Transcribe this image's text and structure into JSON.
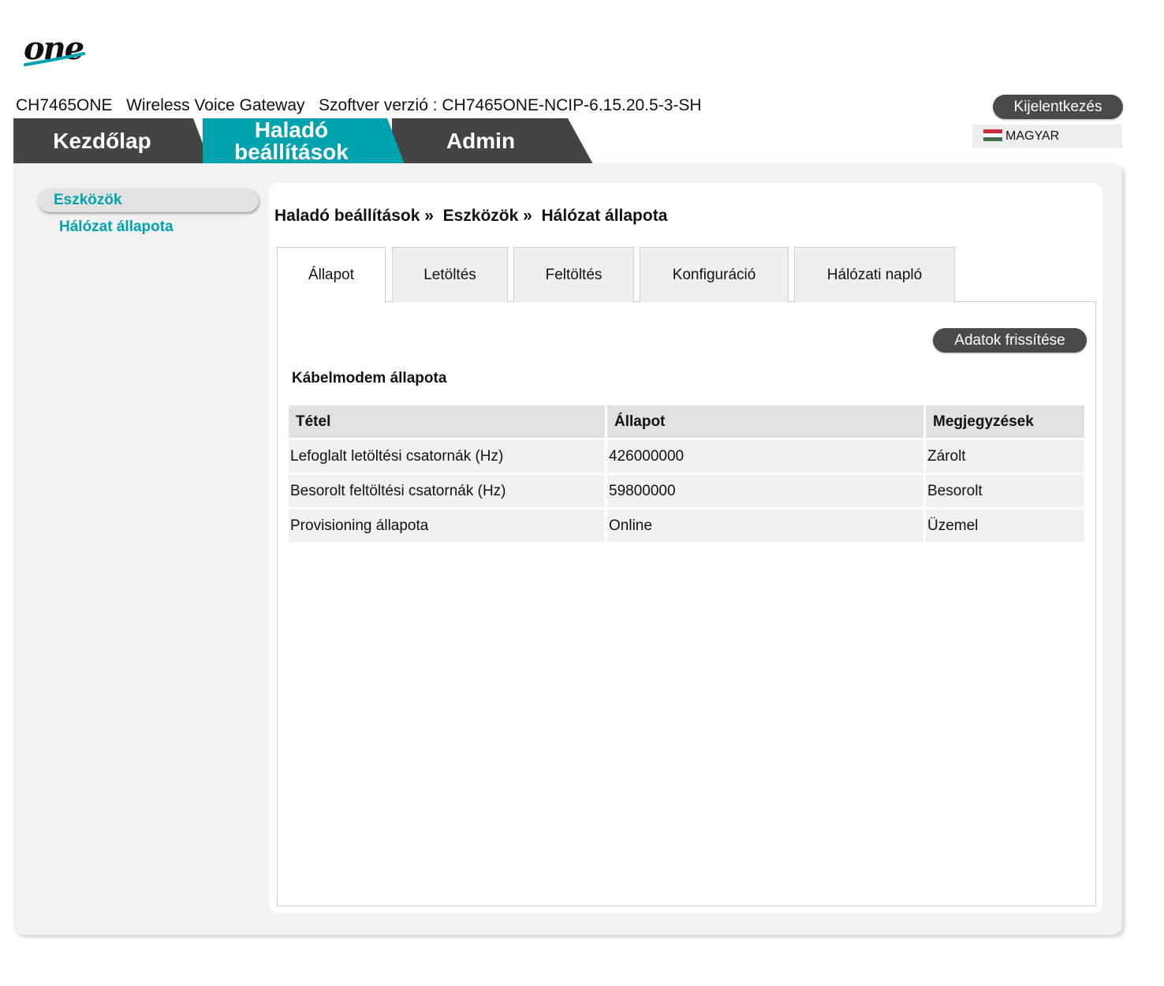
{
  "logo": {
    "text": "one"
  },
  "header": {
    "model": "CH7465ONE",
    "product": "Wireless Voice Gateway",
    "firmware_label": "Szoftver verzió :",
    "firmware": "CH7465ONE-NCIP-6.15.20.5-3-SH",
    "logout_label": "Kijelentkezés",
    "language": "MAGYAR"
  },
  "main_tabs": [
    {
      "label": "Kezdőlap",
      "active": false
    },
    {
      "label": "Haladó beállítások",
      "active": true
    },
    {
      "label": "Admin",
      "active": false
    }
  ],
  "sidebar": {
    "section": "Eszközök",
    "items": [
      {
        "label": "Hálózat állapota",
        "active": true
      }
    ]
  },
  "breadcrumb": {
    "level1": "Haladó beállítások",
    "level2": "Eszközök",
    "level3": "Hálózat állapota",
    "sep": "»"
  },
  "sub_tabs": [
    {
      "label": "Állapot",
      "active": true
    },
    {
      "label": "Letöltés",
      "active": false
    },
    {
      "label": "Feltöltés",
      "active": false
    },
    {
      "label": "Konfiguráció",
      "active": false
    },
    {
      "label": "Hálózati napló",
      "active": false
    }
  ],
  "refresh_label": "Adatok frissítése",
  "section_title": "Kábelmodem állapota",
  "table": {
    "headers": [
      "Tétel",
      "Állapot",
      "Megjegyzések"
    ],
    "rows": [
      [
        "Lefoglalt letöltési csatornák (Hz)",
        "426000000",
        "Zárolt"
      ],
      [
        "Besorolt feltöltési csatornák (Hz)",
        "59800000",
        "Besorolt"
      ],
      [
        "Provisioning állapota",
        "Online",
        "Üzemel"
      ]
    ]
  },
  "colors": {
    "accent": "#00a2ad",
    "tab_dark": "#444444",
    "button_dark": "#4a4a4a"
  },
  "icons": {
    "flag": "hungary-flag-icon"
  }
}
